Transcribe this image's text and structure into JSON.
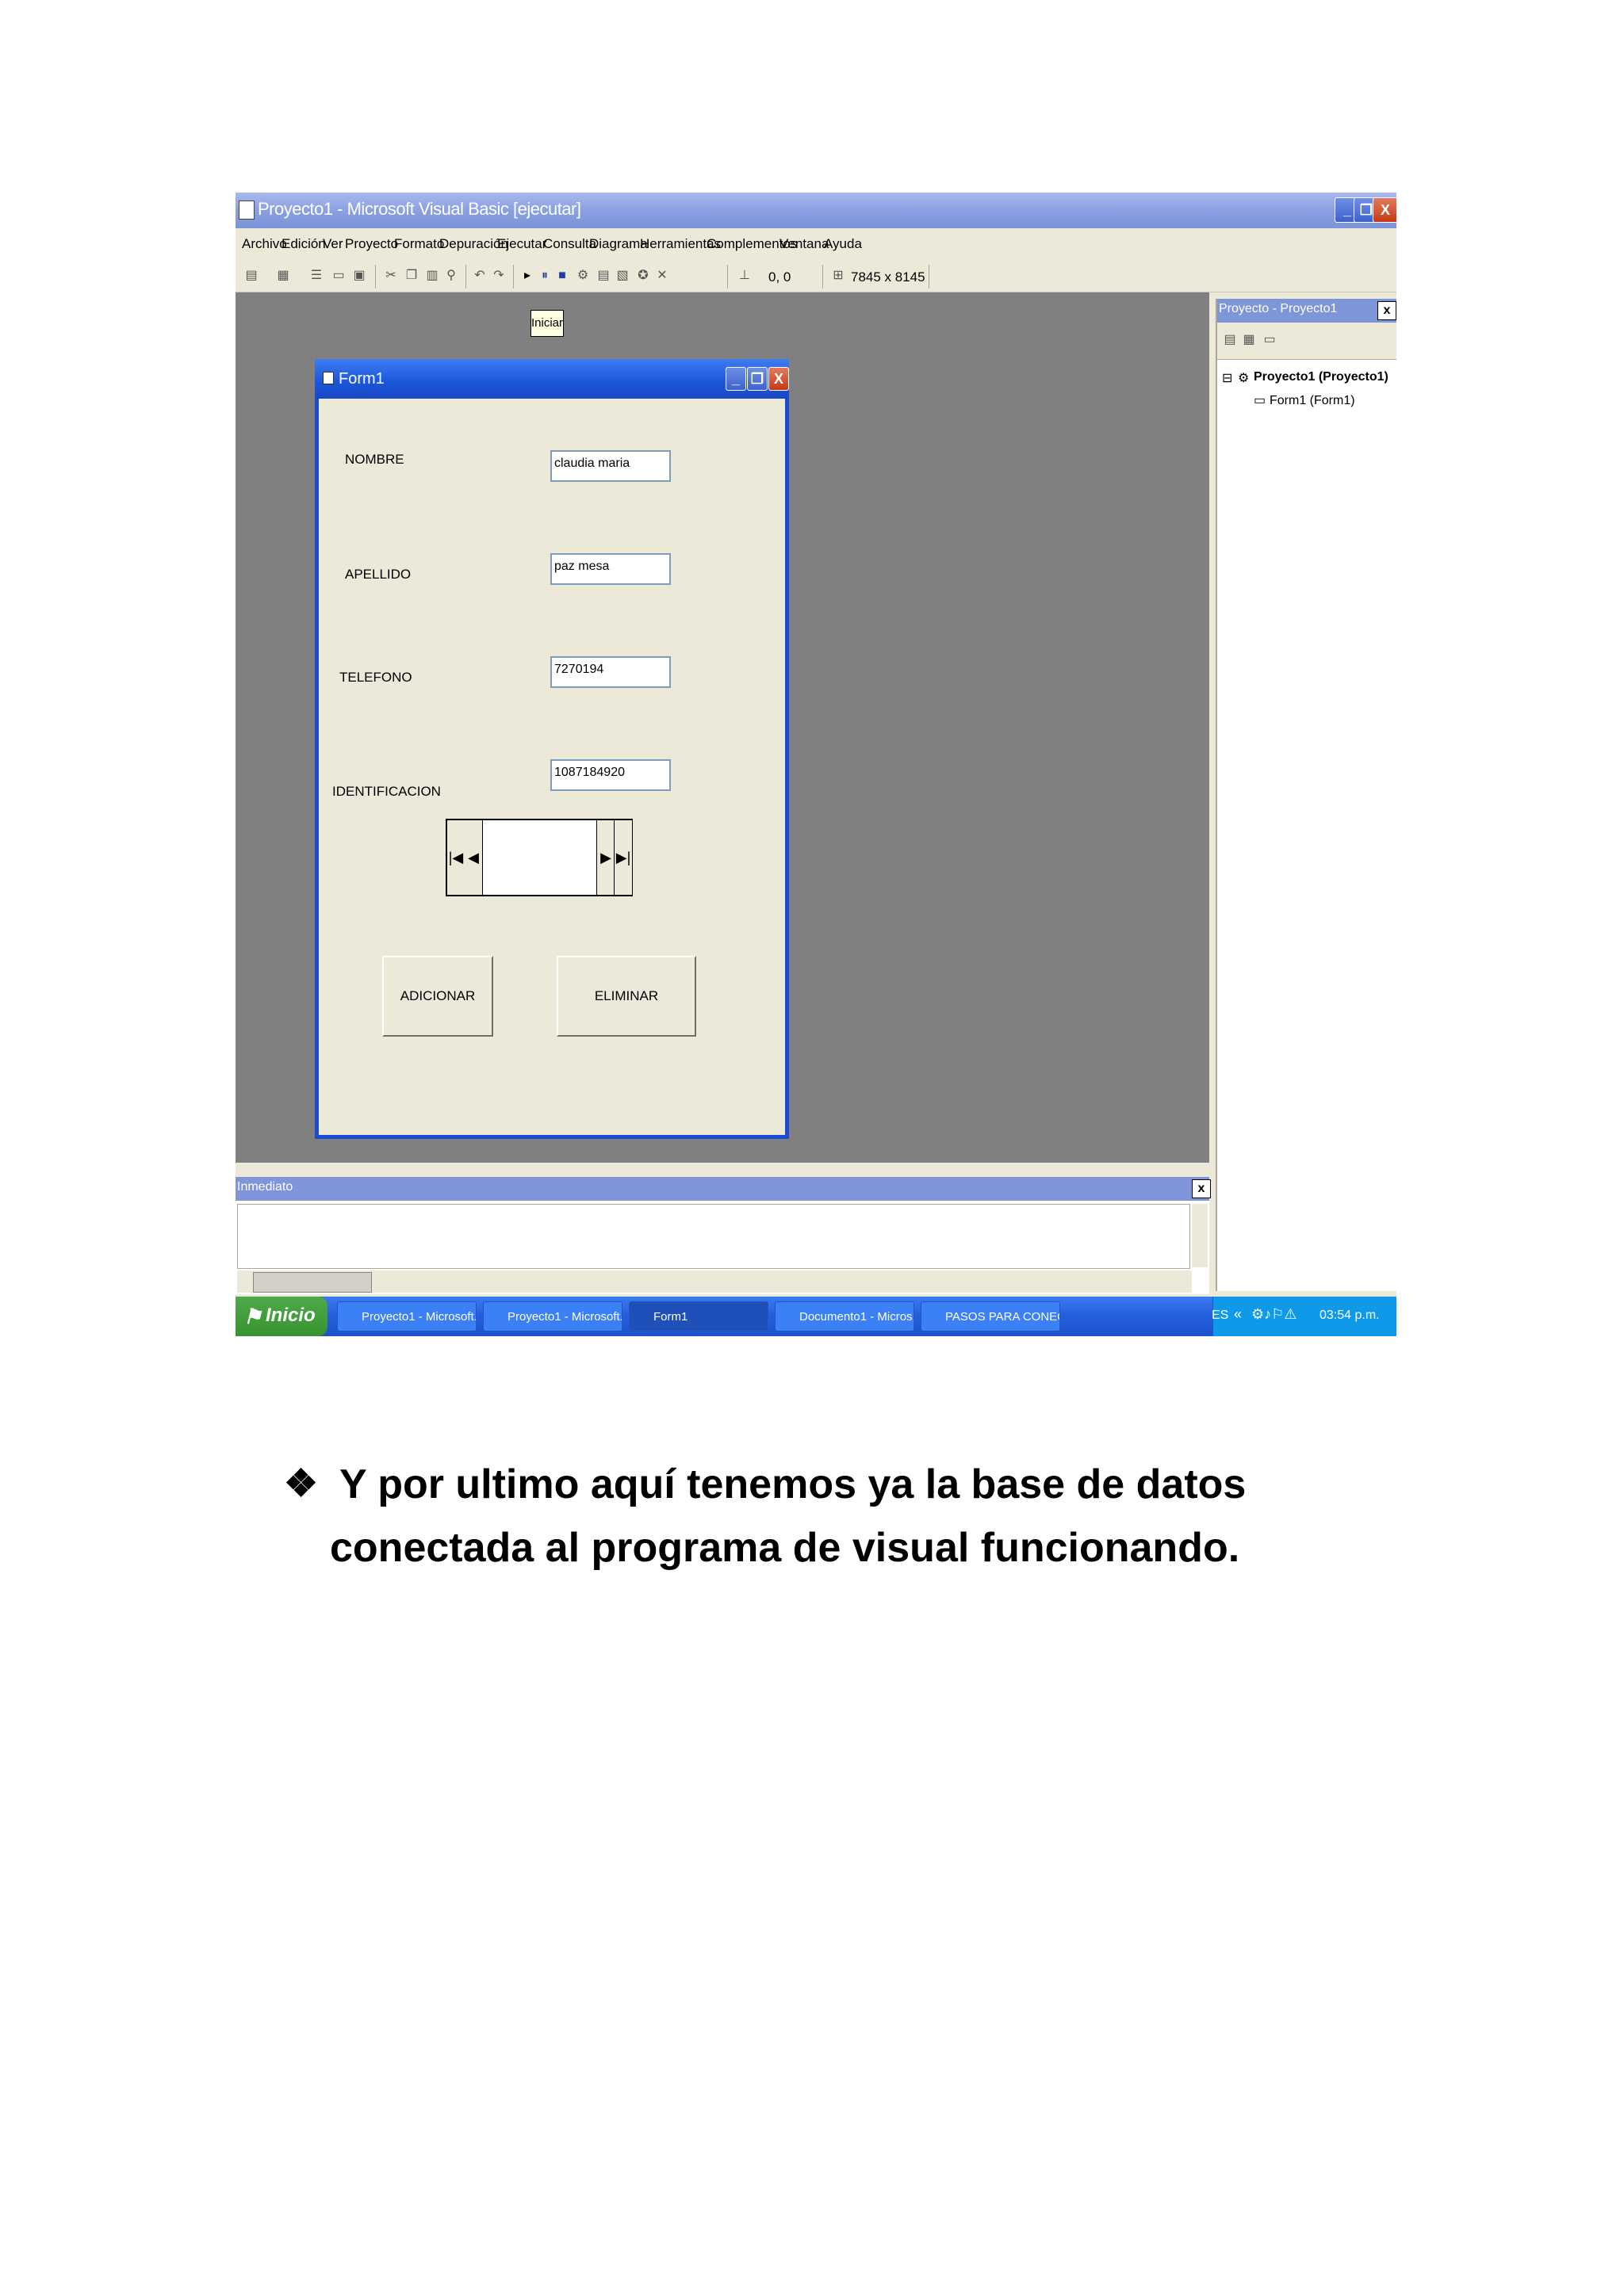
{
  "window": {
    "title": "Proyecto1 - Microsoft Visual Basic [ejecutar]",
    "min_label": "_",
    "restore_label": "❐",
    "close_label": "X"
  },
  "menu": [
    "Archivo",
    "Edición",
    "Ver",
    "Proyecto",
    "Formato",
    "Depuración",
    "Ejecutar",
    "Consulta",
    "Diagrama",
    "Herramientas",
    "Complementos",
    "Ventana",
    "Ayuda"
  ],
  "toolbar": {
    "position": "0, 0",
    "size": "7845 x 8145",
    "tooltip": "Iniciar"
  },
  "form1": {
    "title": "Form1",
    "fields": [
      {
        "label": "NOMBRE",
        "value": "claudia maria"
      },
      {
        "label": "APELLIDO",
        "value": "paz mesa"
      },
      {
        "label": "TELEFONO",
        "value": "7270194"
      },
      {
        "label": "IDENTIFICACION",
        "value": "1087184920"
      }
    ],
    "nav": {
      "first": "|◀",
      "prev": "◀",
      "next": "▶",
      "last": "▶|"
    },
    "add_button": "ADICIONAR",
    "delete_button": "ELIMINAR"
  },
  "project": {
    "title": "Proyecto - Proyecto1",
    "close_label": "x",
    "root": "Proyecto1 (Proyecto1)",
    "child": "Form1 (Form1)",
    "expander": "⊟"
  },
  "immediate": {
    "title": "Inmediato",
    "close_label": "x"
  },
  "taskbar": {
    "start": "Inicio",
    "tasks": [
      {
        "label": "Proyecto1 - Microsoft..."
      },
      {
        "label": "Proyecto1 - Microsoft..."
      },
      {
        "label": "Form1"
      },
      {
        "label": "Documento1 - Micros..."
      },
      {
        "label": "PASOS PARA CONEC..."
      }
    ],
    "lang": "ES",
    "time": "03:54 p.m."
  },
  "caption": {
    "bullet": "❖",
    "line1": "Y por ultimo aquí tenemos ya la base de datos",
    "line2": "conectada al programa de visual funcionando."
  }
}
